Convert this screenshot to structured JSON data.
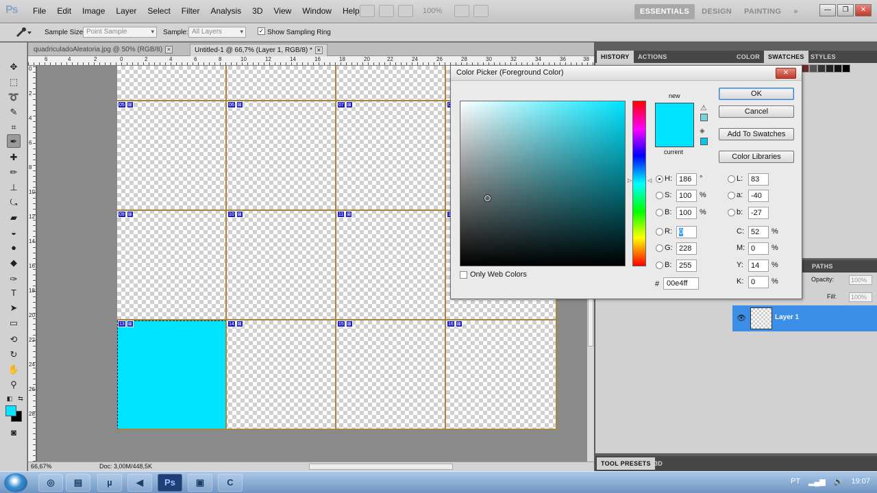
{
  "menubar": {
    "logo": "Ps",
    "items": [
      "File",
      "Edit",
      "Image",
      "Layer",
      "Select",
      "Filter",
      "Analysis",
      "3D",
      "View",
      "Window",
      "Help"
    ],
    "zoom": "100%",
    "workspaces": [
      "ESSENTIALS",
      "DESIGN",
      "PAINTING",
      "»"
    ]
  },
  "options": {
    "sample_size_label": "Sample Size:",
    "sample_size_value": "Point Sample",
    "sample_label": "Sample:",
    "sample_value": "All Layers",
    "show_ring_label": "Show Sampling Ring",
    "show_ring_checked": "✓"
  },
  "doc_tabs": [
    {
      "label": "quadriculadoAleatoria.jpg @ 50% (RGB/8)"
    },
    {
      "label": "Untitled-1 @ 66,7% (Layer 1, RGB/8) *"
    }
  ],
  "ruler_top": [
    "6",
    "4",
    "2",
    "0",
    "2",
    "4",
    "6",
    "8",
    "10",
    "12",
    "14",
    "16",
    "18",
    "20",
    "22",
    "24",
    "26",
    "28",
    "30",
    "32",
    "34",
    "36",
    "38"
  ],
  "ruler_left": [
    "0",
    "2",
    "4",
    "6",
    "8",
    "10",
    "12",
    "14",
    "16",
    "18",
    "20",
    "22",
    "24",
    "26",
    "28"
  ],
  "slices": [
    {
      "num": "05"
    },
    {
      "num": "06"
    },
    {
      "num": "07"
    },
    {
      "num": "08"
    },
    {
      "num": "09"
    },
    {
      "num": "10"
    },
    {
      "num": "11"
    },
    {
      "num": "12"
    },
    {
      "num": "13"
    },
    {
      "num": "14"
    },
    {
      "num": "15"
    },
    {
      "num": "16"
    }
  ],
  "status": {
    "zoom": "66,67%",
    "doc": "Doc: 3,00M/448,5K"
  },
  "panels": {
    "history_tabs": [
      "HISTORY",
      "ACTIONS"
    ],
    "color_tabs": [
      "COLOR",
      "SWATCHES",
      "STYLES"
    ],
    "layers_tabs": [
      "PATHS"
    ],
    "opacity_label": "Opacity:",
    "opacity_value": "100%",
    "fill_label": "Fill:",
    "fill_value": "100%",
    "layer_name": "Layer 1",
    "tool_presets_tabs": [
      "TOOL PRESETS",
      "3D"
    ]
  },
  "dialog": {
    "title": "Color Picker (Foreground Color)",
    "close": "✕",
    "new_label": "new",
    "current_label": "current",
    "ok": "OK",
    "cancel": "Cancel",
    "add_swatches": "Add To Swatches",
    "libraries": "Color Libraries",
    "only_web": "Only Web Colors",
    "new_color": "#00e4ff",
    "current_color": "#00e4ff",
    "h": {
      "label": "H:",
      "value": "186",
      "unit": "°"
    },
    "s": {
      "label": "S:",
      "value": "100",
      "unit": "%"
    },
    "b": {
      "label": "B:",
      "value": "100",
      "unit": "%"
    },
    "r": {
      "label": "R:",
      "value": "0"
    },
    "g": {
      "label": "G:",
      "value": "228"
    },
    "bb": {
      "label": "B:",
      "value": "255"
    },
    "l": {
      "label": "L:",
      "value": "83"
    },
    "a": {
      "label": "a:",
      "value": "-40"
    },
    "b2": {
      "label": "b:",
      "value": "-27"
    },
    "c": {
      "label": "C:",
      "value": "52",
      "unit": "%"
    },
    "m": {
      "label": "M:",
      "value": "0",
      "unit": "%"
    },
    "y": {
      "label": "Y:",
      "value": "14",
      "unit": "%"
    },
    "k": {
      "label": "K:",
      "value": "0",
      "unit": "%"
    },
    "hex_label": "#",
    "hex": "00e4ff"
  },
  "taskbar": {
    "lang": "PT",
    "time": "19:07"
  },
  "colors": {
    "foreground": "#00e4ff",
    "background": "#000000",
    "guide": "#a9873a",
    "selected_layer": "#3d8ee6"
  }
}
